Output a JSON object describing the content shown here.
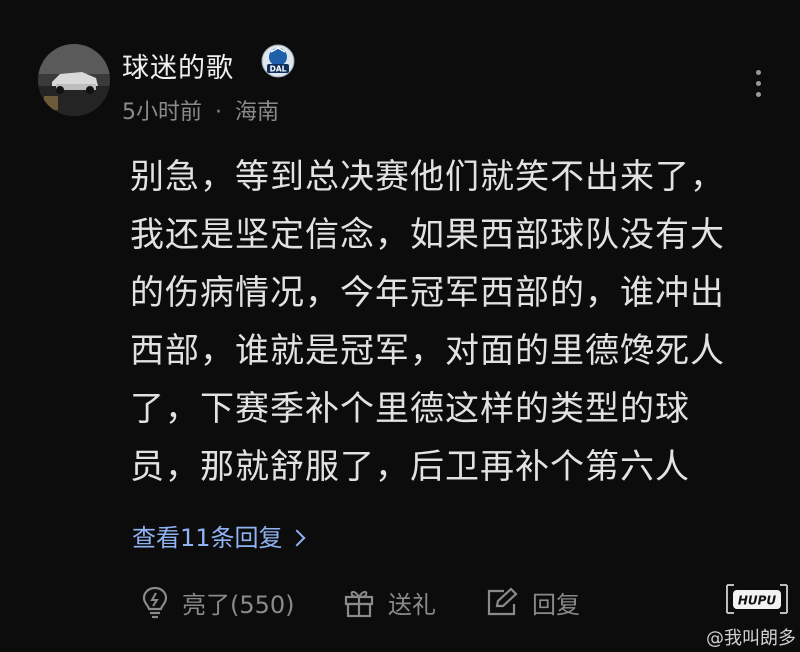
{
  "comment": {
    "username": "球迷的歌",
    "team_badge_text": "DAL",
    "time": "5小时前",
    "separator": "·",
    "location": "海南",
    "lines": [
      "别急，等到总决赛他们就笑不出来了，",
      "我还是坚定信念，如果西部球队没有大",
      "的伤病情况，今年冠军西部的，谁冲出",
      "西部，谁就是冠军，对面的里德馋死人",
      "了，下赛季补个里德这样的类型的球",
      "员，那就舒服了，后卫再补个第六人"
    ],
    "replies_label": "查看11条回复"
  },
  "actions": {
    "light_label": "亮了(550)",
    "gift_label": "送礼",
    "reply_label": "回复"
  },
  "watermark": {
    "logo_text": "HUPU",
    "handle": "@我叫朗多"
  },
  "colors": {
    "background": "#0c0c0c",
    "text": "#e2e2e2",
    "muted": "#8a8a8a",
    "link": "#8fb3f5"
  }
}
